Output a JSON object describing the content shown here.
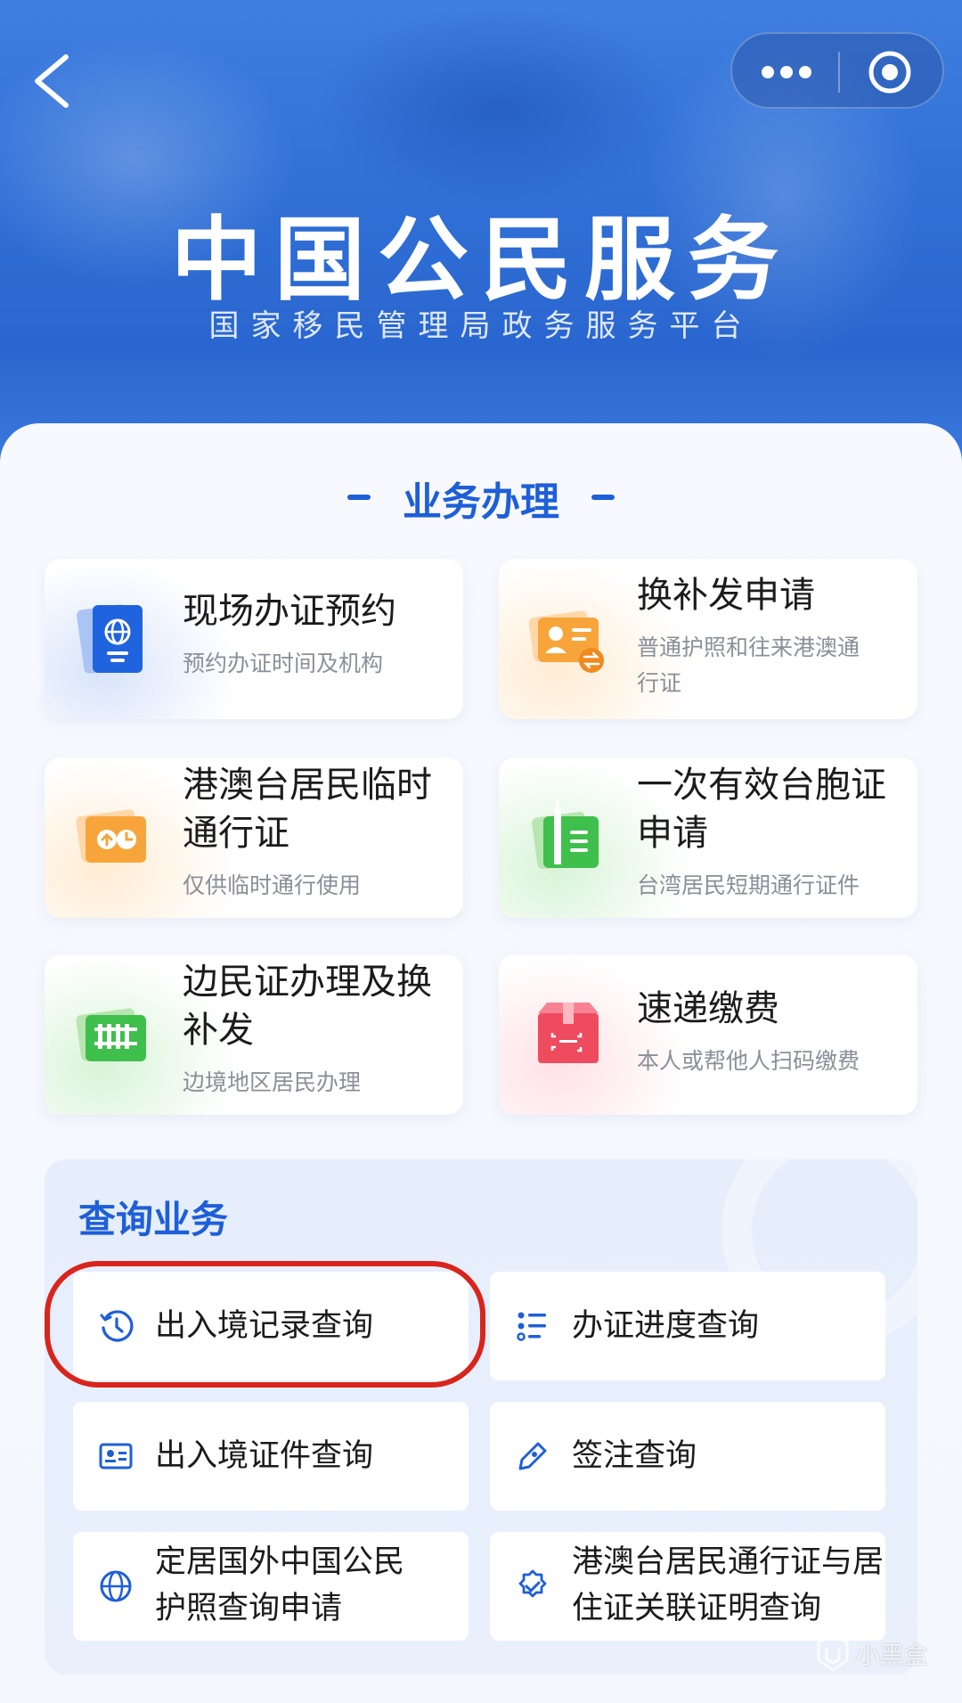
{
  "header": {
    "title": "中国公民服务",
    "subtitle": "国家移民管理局政务服务平台"
  },
  "business": {
    "title": "业务办理",
    "cards": [
      {
        "title_lines": [
          "现场办证预约"
        ],
        "desc_lines": [
          "预约办证时间及机构"
        ],
        "icon": "passport-icon"
      },
      {
        "title_lines": [
          "换补发申请"
        ],
        "desc_lines": [
          "普通护照和往来港澳通",
          "行证"
        ],
        "icon": "id-card-exchange-icon"
      },
      {
        "title_lines": [
          "港澳台居民临时",
          "通行证"
        ],
        "desc_lines": [
          "仅供临时通行使用"
        ],
        "icon": "temporary-pass-icon"
      },
      {
        "title_lines": [
          "一次有效台胞证",
          "申请"
        ],
        "desc_lines": [
          "台湾居民短期通行证件"
        ],
        "icon": "taiwan-permit-icon"
      },
      {
        "title_lines": [
          "边民证办理及换",
          "补发"
        ],
        "desc_lines": [
          "边境地区居民办理"
        ],
        "icon": "border-fence-icon"
      },
      {
        "title_lines": [
          "速递缴费"
        ],
        "desc_lines": [
          "本人或帮他人扫码缴费"
        ],
        "icon": "express-box-icon"
      }
    ]
  },
  "query": {
    "title": "查询业务",
    "items": [
      {
        "label_lines": [
          "出入境记录查询"
        ],
        "icon": "clock-history-icon"
      },
      {
        "label_lines": [
          "办证进度查询"
        ],
        "icon": "progress-list-icon"
      },
      {
        "label_lines": [
          "出入境证件查询"
        ],
        "icon": "id-card-icon"
      },
      {
        "label_lines": [
          "签注查询"
        ],
        "icon": "endorsement-tag-icon"
      },
      {
        "label_lines": [
          "定居国外中国公民",
          "护照查询申请"
        ],
        "icon": "globe-icon"
      },
      {
        "label_lines": [
          "港澳台居民通行证与居",
          "住证关联证明查询"
        ],
        "icon": "verified-badge-icon"
      }
    ]
  },
  "watermark": {
    "text": "小黑盒"
  },
  "colors": {
    "accent": "#1e5fd8",
    "highlight": "#d9241c"
  }
}
